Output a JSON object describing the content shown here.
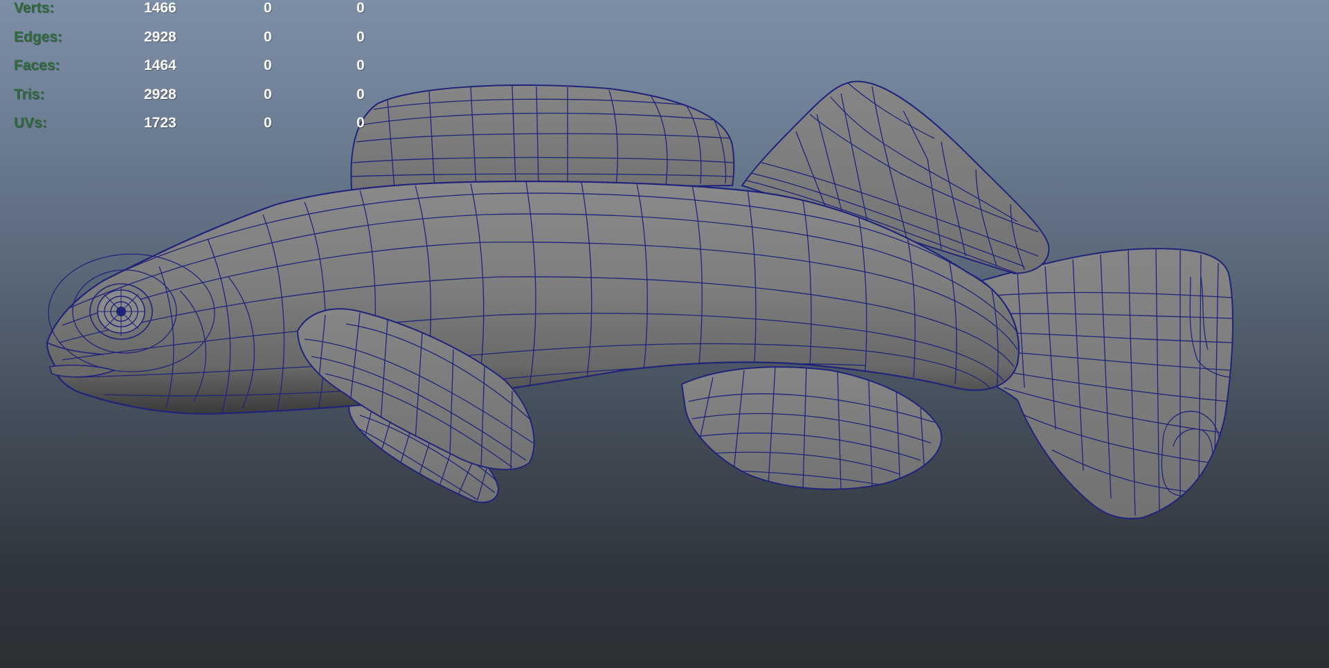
{
  "hud": {
    "rows": [
      {
        "label": "Verts:",
        "values": [
          "1466",
          "0",
          "0"
        ]
      },
      {
        "label": "Edges:",
        "values": [
          "2928",
          "0",
          "0"
        ]
      },
      {
        "label": "Faces:",
        "values": [
          "1464",
          "0",
          "0"
        ]
      },
      {
        "label": "Tris:",
        "values": [
          "2928",
          "0",
          "0"
        ]
      },
      {
        "label": "UVs:",
        "values": [
          "1723",
          "0",
          "0"
        ]
      }
    ]
  },
  "colors": {
    "hud_label": "#2f6a3c",
    "hud_value": "#ffffff",
    "wireframe": "#1f237a",
    "shading": "#7b7b7b"
  },
  "model": {
    "icon": "fish-mesh-wireframe"
  }
}
